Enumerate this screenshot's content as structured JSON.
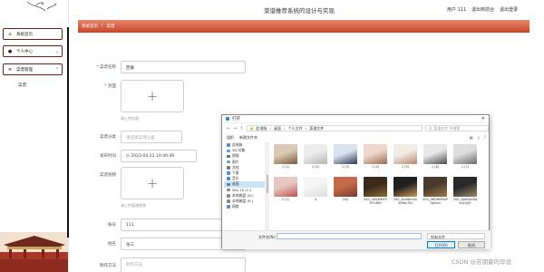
{
  "header": {
    "title": "菜谱推荐系统的设计与实现",
    "user_label": "用户 111",
    "back_label": "退出到前台",
    "logout_label": "退出登录"
  },
  "sidebar": {
    "items": [
      {
        "label": "系统首页",
        "icon": "home-icon"
      },
      {
        "label": "个人中心",
        "icon": "user-icon"
      },
      {
        "label": "菜谱管理",
        "icon": "list-icon"
      }
    ],
    "sub_items": [
      "菜谱"
    ]
  },
  "breadcrumb": {
    "home": "系统首页",
    "current": "菜谱"
  },
  "form": {
    "fields": {
      "name": {
        "label": "菜谱名称",
        "value": "西餐"
      },
      "cover": {
        "label": "封面",
        "hint": "请上传封面"
      },
      "category": {
        "label": "菜谱分类",
        "placeholder": "请选择菜谱分类"
      },
      "publish_time": {
        "label": "发布时间",
        "value": "2023-04-22 10:40:49"
      },
      "step_image": {
        "label": "菜谱视频",
        "hint": "请上传菜谱视频"
      },
      "account": {
        "label": "账号",
        "value": "111"
      },
      "nickname": {
        "label": "姓名",
        "value": "张三"
      },
      "method": {
        "label": "制作方法",
        "placeholder": "制作方法"
      }
    }
  },
  "dialog": {
    "title": "打开",
    "path": [
      "此电脑",
      "桌面",
      "个人文件",
      "菜谱文件"
    ],
    "search_placeholder": "在 菜谱文件 中搜索",
    "toolbar": {
      "organize": "组织",
      "new_folder": "新建文件夹"
    },
    "nav": [
      {
        "label": "此电脑",
        "color": "#4a90d9"
      },
      {
        "label": "3D 对象",
        "color": "#5aa0e0"
      },
      {
        "label": "视频",
        "color": "#6a6a6a"
      },
      {
        "label": "图片",
        "color": "#6a9ad0"
      },
      {
        "label": "文档",
        "color": "#7a7a7a"
      },
      {
        "label": "下载",
        "color": "#4a90d9"
      },
      {
        "label": "音乐",
        "color": "#4a90d9"
      },
      {
        "label": "桌面",
        "color": "#4a80c9"
      },
      {
        "label": "Win 10 (C:)",
        "color": "#888888"
      },
      {
        "label": "本地磁盘 (D:)",
        "color": "#888888"
      },
      {
        "label": "本地磁盘 (E:)",
        "color": "#888888"
      },
      {
        "label": "网络",
        "color": "#5a8ad0"
      }
    ],
    "files": [
      {
        "name": "1 (1)",
        "c1": "#d9c9b5",
        "c2": "#7a5a3a"
      },
      {
        "name": "1 (2)",
        "c1": "#ececec",
        "c2": "#b5b5b5"
      },
      {
        "name": "1 (3)",
        "c1": "#d9e2ef",
        "c2": "#2c3a55"
      },
      {
        "name": "1 (4)",
        "c1": "#f0d6cb",
        "c2": "#9a6a50"
      },
      {
        "name": "1 (5)",
        "c1": "#f2ebe6",
        "c2": "#b58870"
      },
      {
        "name": "1 (6)",
        "c1": "#e8e8e8",
        "c2": "#4a4a4a"
      },
      {
        "name": "1 (7)",
        "c1": "#dedede",
        "c2": "#6a6a6a"
      },
      {
        "name": "2 (1)",
        "c1": "#e6c8c0",
        "c2": "#c05050"
      },
      {
        "name": "4",
        "c1": "#f5f5f5",
        "c2": "#dcdcdc"
      },
      {
        "name": "202",
        "c1": "#c26a4a",
        "c2": "#7a3a2a"
      },
      {
        "name": "200_0MLMMF5YOG8IH",
        "c1": "#3a2a1a",
        "c2": "#8a6a3a"
      },
      {
        "name": "200_2bcNhmtyW9bc7KI",
        "c1": "#202020",
        "c2": "#d09a5a"
      },
      {
        "name": "200_9KDW96aPTgbmv",
        "c1": "#4a3a2a",
        "c2": "#a07a4a"
      },
      {
        "name": "200_DpB4kz9qw1JlyjJY",
        "c1": "#2a2a2a",
        "c2": "#9a8a6a"
      }
    ],
    "filename_label": "文件名(N):",
    "filetype": "所有文件",
    "open_label": "打开(O)",
    "cancel_label": "取消"
  },
  "watermark": "CSDN @苏朋豪的毕设"
}
